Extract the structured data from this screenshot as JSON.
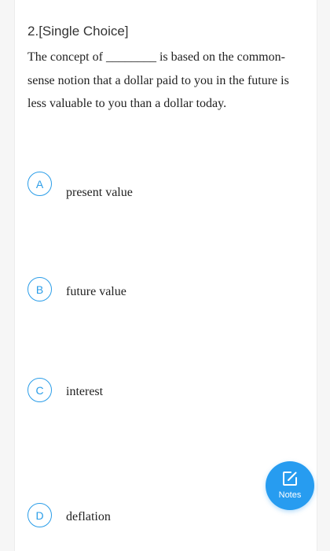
{
  "question": {
    "number_label": "2.",
    "type_label": "[Single Choice]",
    "stem": "The concept of ________ is based on the common-sense notion that a dollar paid to you in the future is less valuable to you than a dollar today."
  },
  "options": [
    {
      "letter": "A",
      "text": "present value"
    },
    {
      "letter": "B",
      "text": "future value"
    },
    {
      "letter": "C",
      "text": "interest"
    },
    {
      "letter": "D",
      "text": "deflation"
    }
  ],
  "notes_button": {
    "label": "Notes",
    "icon": "edit-note-icon"
  },
  "colors": {
    "accent": "#2a9de8",
    "notes_bg": "#279cf0",
    "text": "#222222",
    "page_bg": "#f6f6f6"
  }
}
